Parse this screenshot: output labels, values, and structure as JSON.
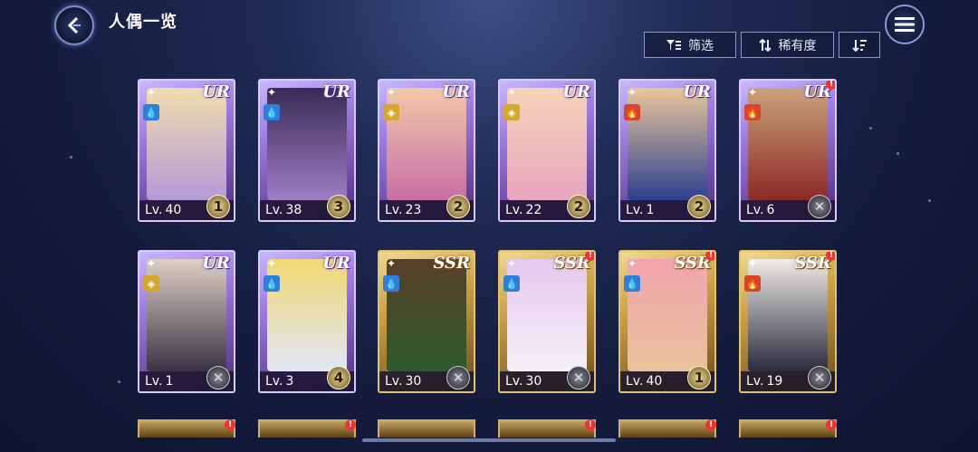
{
  "header": {
    "title": "人偶一览",
    "back_icon": "chevron-left-icon",
    "menu_icon": "hamburger-icon"
  },
  "toolbar": {
    "filter_label": "筛选",
    "sort_label": "稀有度",
    "filter_icon": "filter-icon",
    "sort_icon": "sort-arrows-icon",
    "order_icon": "sort-desc-icon"
  },
  "colors": {
    "ur_frame": "#d8c9ff",
    "ssr_frame": "#e0c372",
    "background": "#141b3c",
    "alert": "#e33333"
  },
  "cards": [
    {
      "rarity": "UR",
      "level_prefix": "Lv.",
      "level": "40",
      "stars": "1",
      "element": "water",
      "alert": false,
      "portrait": [
        "#f1dcae",
        "#b49ad6"
      ]
    },
    {
      "rarity": "UR",
      "level_prefix": "Lv.",
      "level": "38",
      "stars": "3",
      "element": "water",
      "alert": false,
      "portrait": [
        "#3a2a55",
        "#9d7fc5"
      ]
    },
    {
      "rarity": "UR",
      "level_prefix": "Lv.",
      "level": "23",
      "stars": "2",
      "element": "light",
      "alert": false,
      "portrait": [
        "#f3c8a8",
        "#c66fa4"
      ]
    },
    {
      "rarity": "UR",
      "level_prefix": "Lv.",
      "level": "22",
      "stars": "2",
      "element": "light",
      "alert": false,
      "portrait": [
        "#f6d4b8",
        "#e8a5c0"
      ]
    },
    {
      "rarity": "UR",
      "level_prefix": "Lv.",
      "level": " 1",
      "stars": "2",
      "element": "fire",
      "alert": false,
      "portrait": [
        "#e9c79a",
        "#2c3f8f"
      ]
    },
    {
      "rarity": "UR",
      "level_prefix": "Lv.",
      "level": " 6",
      "stars": "",
      "element": "fire",
      "alert": true,
      "portrait": [
        "#caa27c",
        "#8b2a24"
      ]
    },
    {
      "rarity": "UR",
      "level_prefix": "Lv.",
      "level": " 1",
      "stars": "",
      "element": "light",
      "alert": false,
      "portrait": [
        "#ddd0c4",
        "#3a3344"
      ]
    },
    {
      "rarity": "UR",
      "level_prefix": "Lv.",
      "level": " 3",
      "stars": "4",
      "element": "water",
      "alert": false,
      "portrait": [
        "#f2d874",
        "#dfe6f5"
      ]
    },
    {
      "rarity": "SSR",
      "level_prefix": "Lv.",
      "level": "30",
      "stars": "",
      "element": "water",
      "alert": false,
      "portrait": [
        "#5a3e2a",
        "#2e5a2c"
      ]
    },
    {
      "rarity": "SSR",
      "level_prefix": "Lv.",
      "level": "30",
      "stars": "",
      "element": "water",
      "alert": true,
      "portrait": [
        "#e6c8ef",
        "#f4f0f7"
      ]
    },
    {
      "rarity": "SSR",
      "level_prefix": "Lv.",
      "level": "40",
      "stars": "1",
      "element": "water",
      "alert": true,
      "portrait": [
        "#f1a4ae",
        "#e9c29b"
      ]
    },
    {
      "rarity": "SSR",
      "level_prefix": "Lv.",
      "level": "19",
      "stars": "",
      "element": "fire",
      "alert": true,
      "portrait": [
        "#f0ece8",
        "#2b2a3c"
      ]
    }
  ],
  "partial_row": [
    {
      "rarity": "SSR",
      "alert": true
    },
    {
      "rarity": "SSR",
      "alert": true
    },
    {
      "rarity": "SSR",
      "alert": false
    },
    {
      "rarity": "SSR",
      "alert": true
    },
    {
      "rarity": "SSR",
      "alert": true
    },
    {
      "rarity": "SSR",
      "alert": true
    }
  ]
}
